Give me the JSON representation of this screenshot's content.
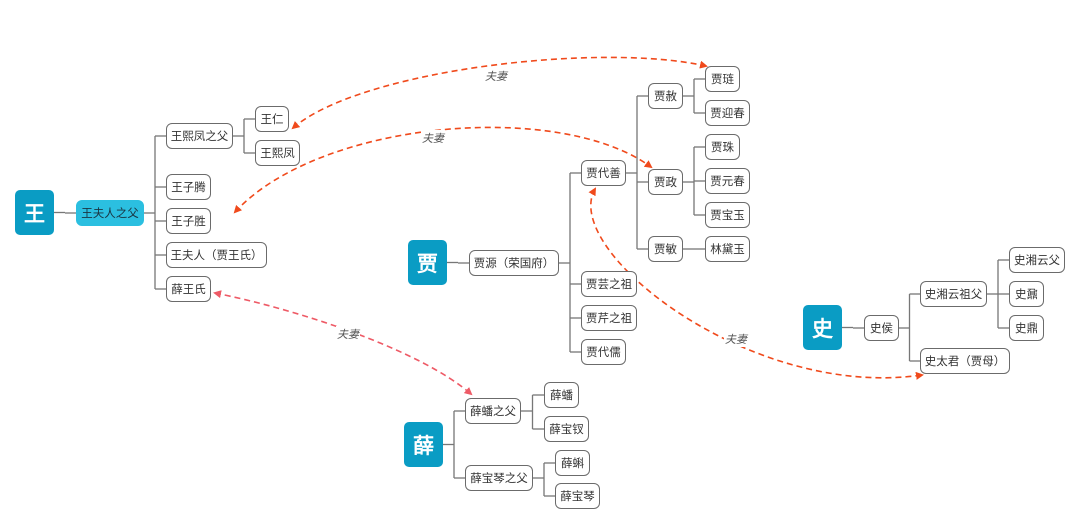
{
  "families": [
    {
      "root": "王",
      "tree": {
        "label": "王夫人之父",
        "highlight": true,
        "children": [
          {
            "label": "王熙凤之父",
            "children": [
              {
                "label": "王仁"
              },
              {
                "label": "王熙凤"
              }
            ]
          },
          {
            "label": "王子腾"
          },
          {
            "label": "王子胜"
          },
          {
            "label": "王夫人（贾王氏）"
          },
          {
            "label": "薛王氏"
          }
        ]
      }
    },
    {
      "root": "贾",
      "tree": {
        "label": "贾源（荣国府）",
        "children": [
          {
            "label": "贾代善",
            "children": [
              {
                "label": "贾赦",
                "children": [
                  {
                    "label": "贾琏"
                  },
                  {
                    "label": "贾迎春"
                  }
                ]
              },
              {
                "label": "贾政",
                "children": [
                  {
                    "label": "贾珠"
                  },
                  {
                    "label": "贾元春"
                  },
                  {
                    "label": "贾宝玉"
                  }
                ]
              },
              {
                "label": "贾敏",
                "children": [
                  {
                    "label": "林黛玉"
                  }
                ]
              }
            ]
          },
          {
            "label": "贾芸之祖"
          },
          {
            "label": "贾芹之祖"
          },
          {
            "label": "贾代儒"
          }
        ]
      }
    },
    {
      "root": "史",
      "tree": {
        "label": "史侯",
        "children": [
          {
            "label": "史湘云祖父",
            "children": [
              {
                "label": "史湘云父"
              },
              {
                "label": "史鼐"
              },
              {
                "label": "史鼎"
              }
            ]
          },
          {
            "label": "史太君（贾母）"
          }
        ]
      }
    },
    {
      "root": "薛",
      "tree": {
        "label": "",
        "children": []
      },
      "branches": [
        {
          "label": "薛蟠之父",
          "children": [
            {
              "label": "薛蟠"
            },
            {
              "label": "薛宝钗"
            }
          ]
        },
        {
          "label": "薛宝琴之父",
          "children": [
            {
              "label": "薛蝌"
            },
            {
              "label": "薛宝琴"
            }
          ]
        }
      ]
    }
  ],
  "relations": [
    {
      "label": "夫妻",
      "from": "王熙凤",
      "to": "贾琏"
    },
    {
      "label": "夫妻",
      "from": "王夫人（贾王氏）",
      "to": "贾政"
    },
    {
      "label": "夫妻",
      "from": "薛王氏",
      "to": "薛蟠之父"
    },
    {
      "label": "夫妻",
      "from": "贾代善",
      "to": "史太君（贾母）"
    }
  ],
  "colors": {
    "root": "#0a9cc4",
    "highlight": "#2bbfe0",
    "relation": "#f04a1c",
    "relation_alt": "#ee5a66",
    "connector": "#777777"
  }
}
